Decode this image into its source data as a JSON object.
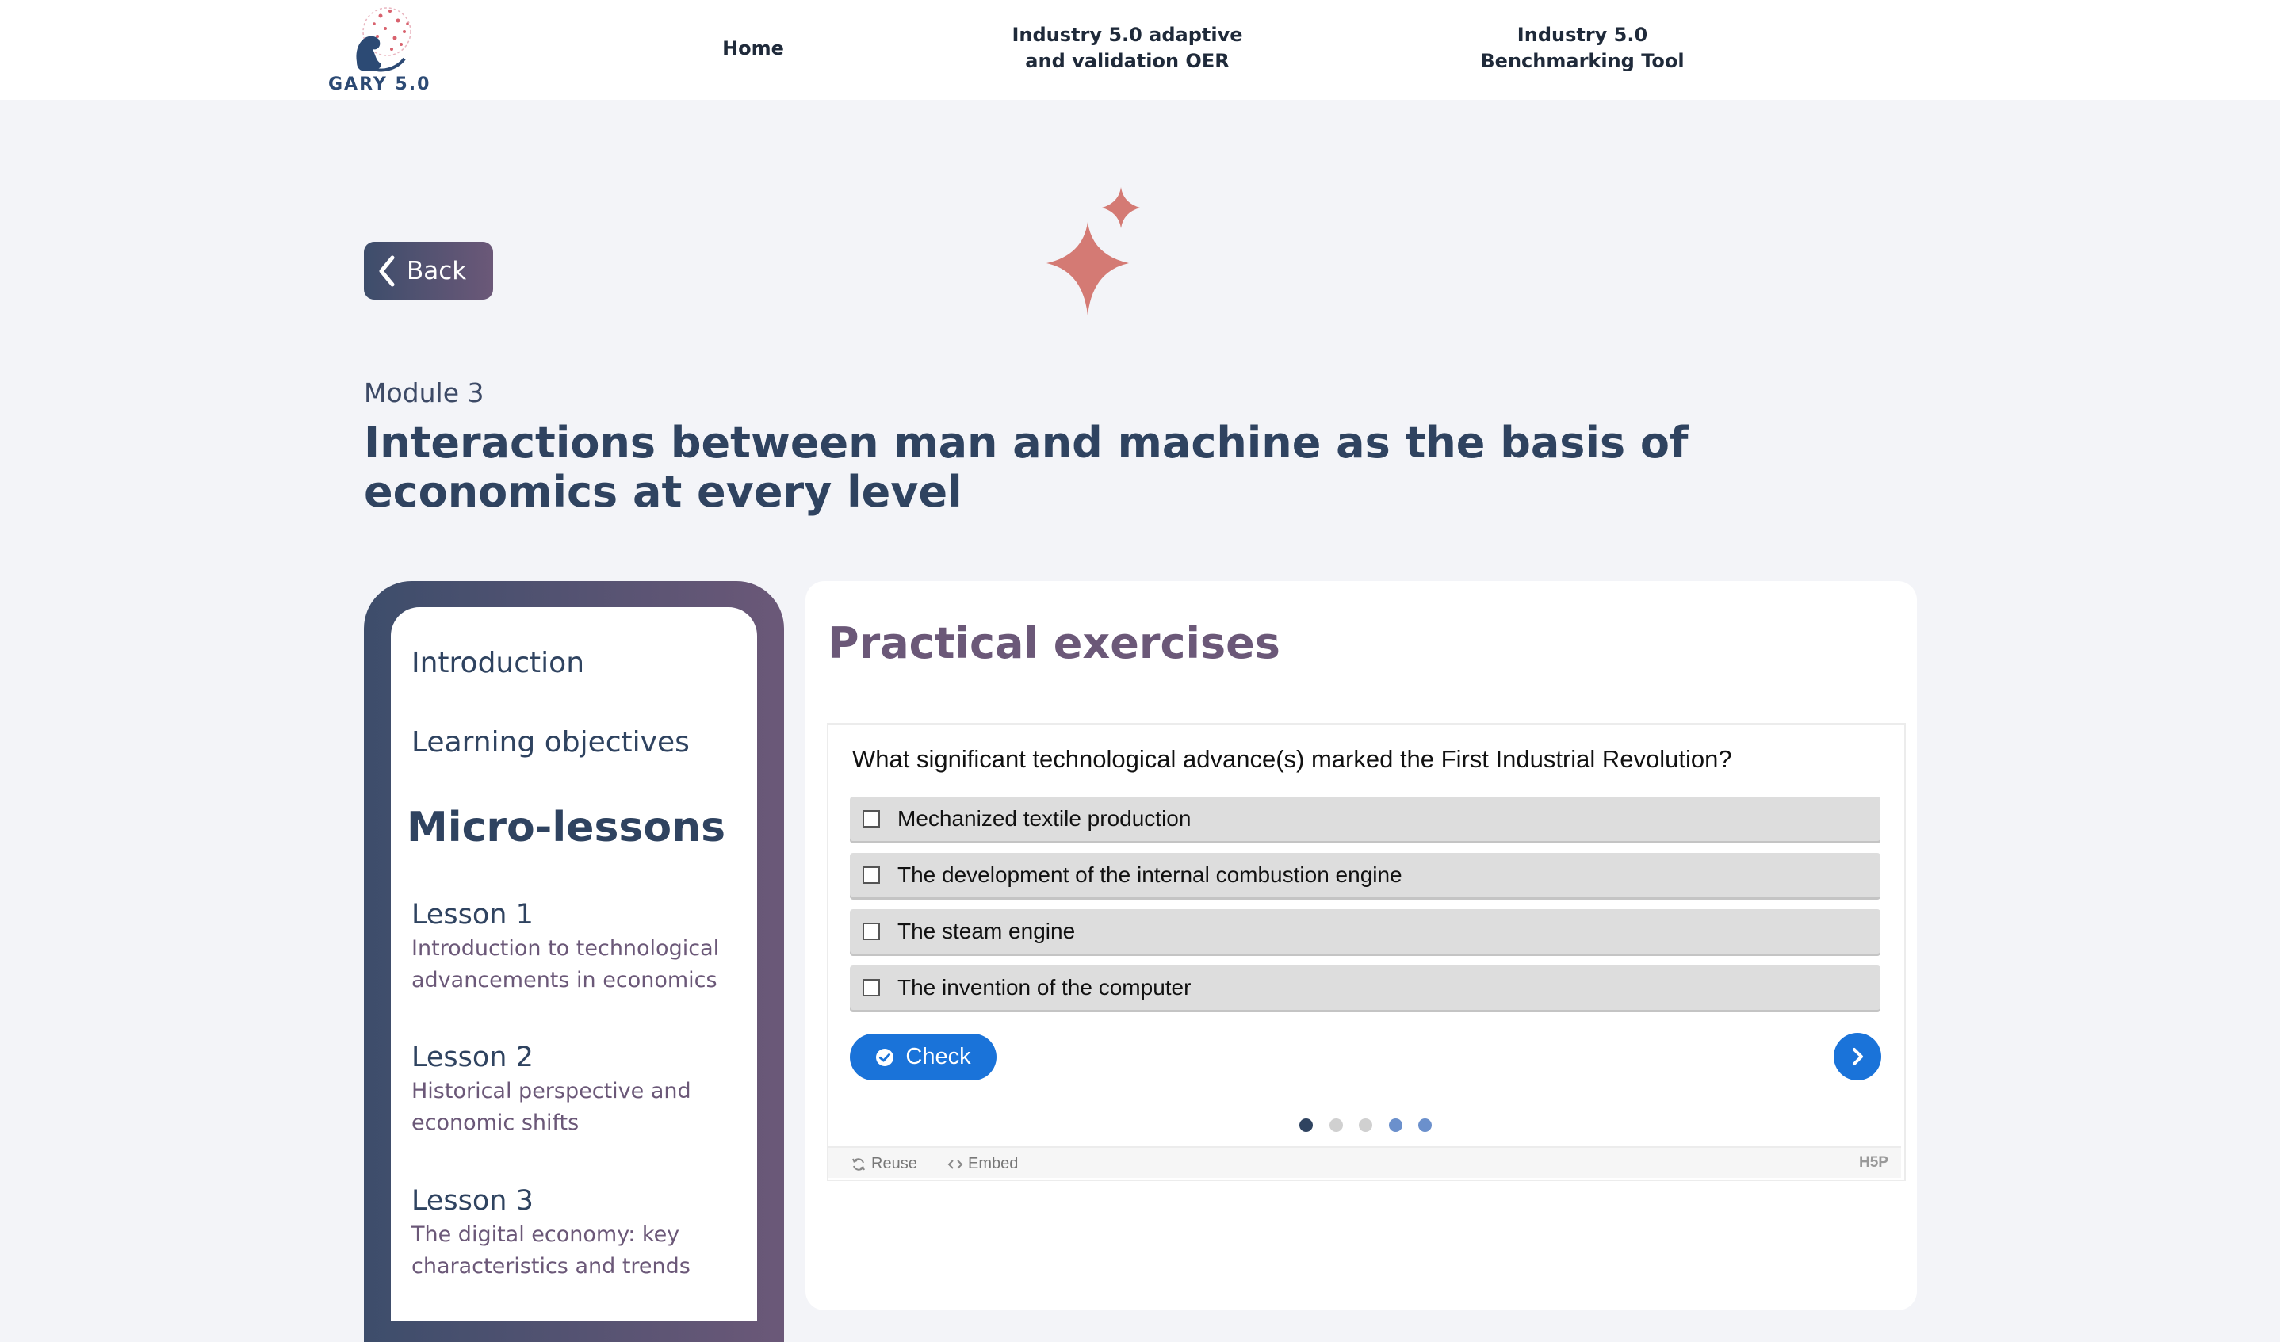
{
  "header": {
    "logo_text": "GARY 5.0",
    "nav": {
      "home": "Home",
      "oer_line1": "Industry 5.0 adaptive",
      "oer_line2": "and validation OER",
      "bench_line1": "Industry 5.0",
      "bench_line2": "Benchmarking Tool"
    }
  },
  "back_label": "Back",
  "module_label": "Module 3",
  "page_title": "Interactions between man and machine as the basis of economics at every level",
  "sidebar": {
    "introduction": "Introduction",
    "learning_objectives": "Learning objectives",
    "heading": "Micro-lessons",
    "lessons": [
      {
        "title": "Lesson 1",
        "desc": "Introduction to technological advancements in economics"
      },
      {
        "title": "Lesson 2",
        "desc": "Historical perspective and economic shifts"
      },
      {
        "title": "Lesson 3",
        "desc": "The digital economy: key characteristics and trends"
      }
    ]
  },
  "main": {
    "section_title": "Practical exercises",
    "question": "What significant technological advance(s) marked the First Industrial Revolution?",
    "answers": [
      "Mechanized textile production",
      "The development of the internal combustion engine",
      "The steam engine",
      "The invention of the computer"
    ],
    "check_label": "Check",
    "pagination": {
      "current": 1,
      "total": 5
    },
    "footer": {
      "reuse": "Reuse",
      "embed": "Embed",
      "brand": "H5P"
    }
  },
  "colors": {
    "accent_blue": "#1a73d9",
    "title_navy": "#2f4360",
    "purple": "#6b5878",
    "sparkle": "#d47a74",
    "page_bg": "#f3f4f8"
  },
  "icons": [
    "chevron-left-icon",
    "sparkle-icon",
    "check-circle-icon",
    "chevron-right-icon",
    "reuse-icon",
    "embed-icon"
  ]
}
